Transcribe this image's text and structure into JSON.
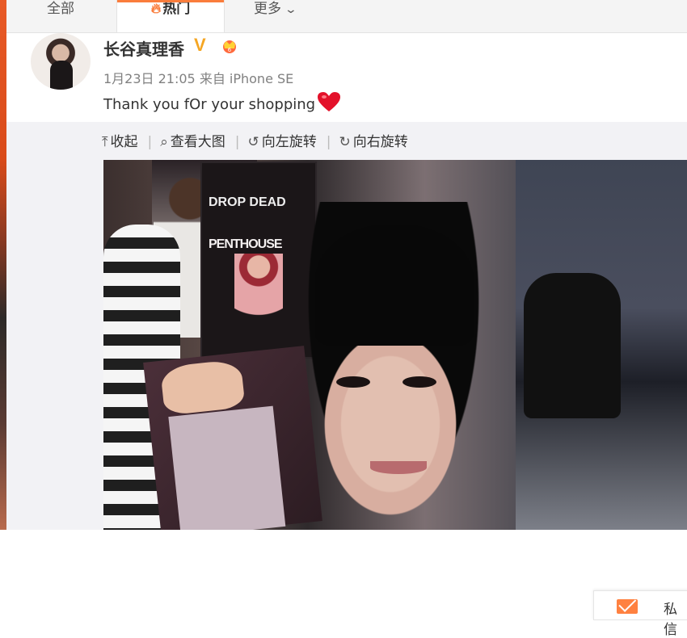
{
  "tabs": {
    "all": "全部",
    "hot": "热门",
    "more": "更多"
  },
  "post": {
    "username": "长谷真理香",
    "verified_mark": "V",
    "meta": "1月23日 21:05 来自 iPhone SE",
    "text": "Thank you fOr your shopping"
  },
  "toolbar": {
    "collapse": "收起",
    "view_large": "查看大图",
    "rotate_left": "向左旋转",
    "rotate_right": "向右旋转"
  },
  "photo": {
    "poster_line1": "DROP DEAD",
    "poster_line2": "PENTHOUSE"
  },
  "chat": {
    "label": "私信"
  },
  "colors": {
    "accent": "#fa7d3c",
    "verified": "#f5a623"
  }
}
